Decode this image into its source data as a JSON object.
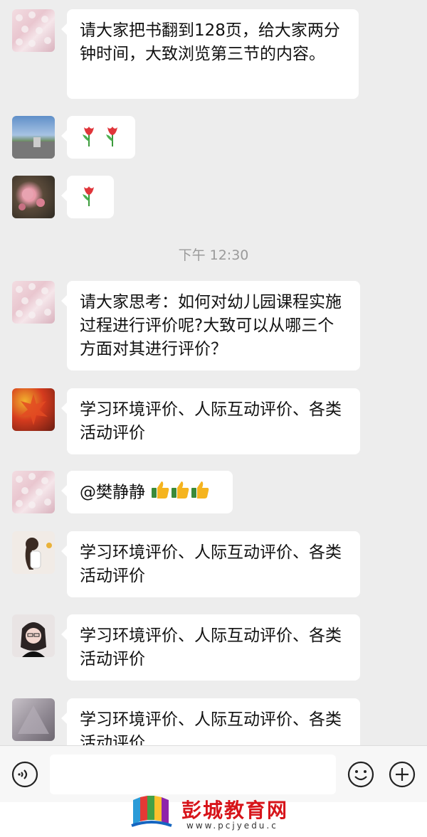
{
  "messages": [
    {
      "avatar": "flower-wall",
      "text": "请大家把书翻到128页，给大家两分钟时间，大致浏览第三节的内容。"
    },
    {
      "avatar": "landscape",
      "emoji": [
        "tulip",
        "tulip"
      ]
    },
    {
      "avatar": "plum-blossom",
      "emoji": [
        "tulip"
      ]
    },
    {
      "avatar": "flower-wall",
      "text": "请大家思考：如何对幼儿园课程实施过程进行评价呢?大致可以从哪三个方面对其进行评价？"
    },
    {
      "avatar": "maple-leaves",
      "text": "学习环境评价、人际互动评价、各类活动评价"
    },
    {
      "avatar": "flower-wall",
      "mention": "@樊静静",
      "emoji": [
        "thumbs-up",
        "thumbs-up",
        "thumbs-up"
      ]
    },
    {
      "avatar": "girl-illustration",
      "text": "学习环境评价、人际互动评价、各类活动评价"
    },
    {
      "avatar": "girl-glasses",
      "text": "学习环境评价、人际互动评价、各类活动评价"
    },
    {
      "avatar": "gray-photo",
      "text": "学习环境评价、人际互动评价、各类活动评价"
    }
  ],
  "timestamp": "下午 12:30",
  "input": {
    "voice_icon": "voice-icon",
    "emoji_icon": "smiley-icon",
    "add_icon": "plus-icon"
  },
  "watermark": {
    "name": "彭城教育网",
    "url": "www.pcjyedu.c"
  },
  "colors": {
    "background": "#ededed",
    "bubble": "#ffffff",
    "tulip": "#e0353a",
    "brand": "#d7141a"
  }
}
